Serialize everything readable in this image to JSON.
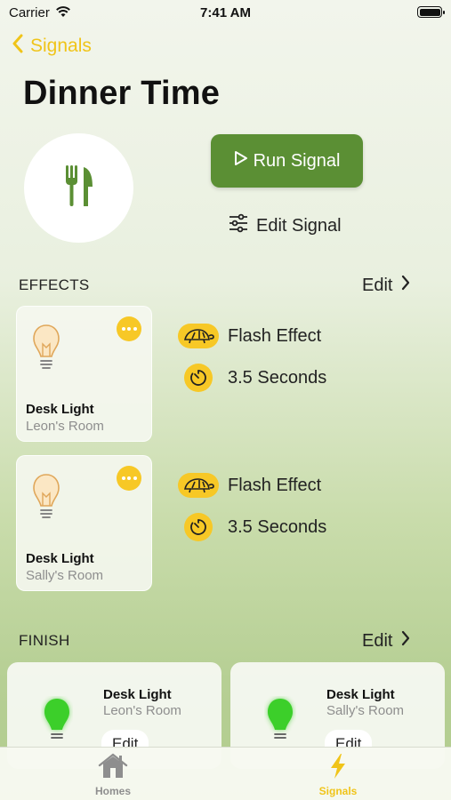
{
  "status_bar": {
    "carrier": "Carrier",
    "time": "7:41 AM"
  },
  "nav": {
    "back_label": "Signals"
  },
  "title": "Dinner Time",
  "signal_icon": "fork-knife-icon",
  "actions": {
    "run_label": "Run Signal",
    "edit_label": "Edit Signal"
  },
  "effects": {
    "heading": "EFFECTS",
    "edit_label": "Edit",
    "items": [
      {
        "name": "Desk Light",
        "room": "Leon's Room",
        "effect": "Flash Effect",
        "duration": "3.5 Seconds"
      },
      {
        "name": "Desk Light",
        "room": "Sally's Room",
        "effect": "Flash Effect",
        "duration": "3.5 Seconds"
      }
    ]
  },
  "finish": {
    "heading": "FINISH",
    "edit_label": "Edit",
    "items": [
      {
        "name": "Desk Light",
        "room": "Leon's Room",
        "edit_label": "Edit"
      },
      {
        "name": "Desk Light",
        "room": "Sally's Room",
        "edit_label": "Edit"
      }
    ]
  },
  "tabs": [
    {
      "label": "Homes",
      "icon": "house-icon",
      "active": false
    },
    {
      "label": "Signals",
      "icon": "bolt-icon",
      "active": true
    }
  ],
  "colors": {
    "accent": "#f0c419",
    "run_button": "#5b8f34",
    "badge": "#f7c826",
    "finish_bulb": "#3ccf2a"
  }
}
